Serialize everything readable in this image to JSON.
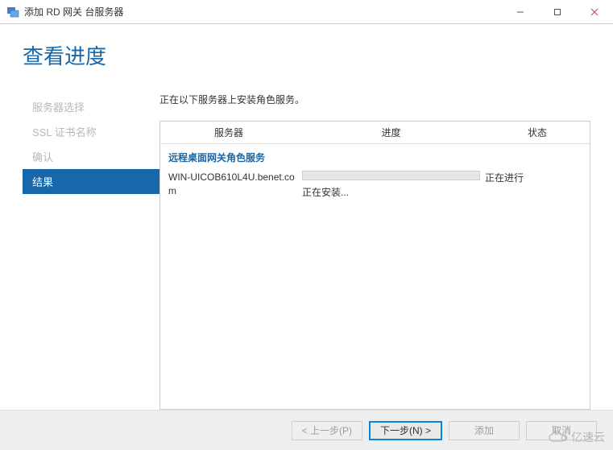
{
  "window": {
    "title": "添加 RD 网关 台服务器"
  },
  "page": {
    "heading": "查看进度",
    "intro": "正在以下服务器上安装角色服务。"
  },
  "sidebar": {
    "steps": [
      {
        "label": "服务器选择"
      },
      {
        "label": "SSL 证书名称"
      },
      {
        "label": "确认"
      },
      {
        "label": "结果"
      }
    ]
  },
  "table": {
    "headers": {
      "server": "服务器",
      "progress": "进度",
      "status": "状态"
    },
    "section_title": "远程桌面网关角色服务",
    "rows": [
      {
        "server": "WIN-UICOB610L4U.benet.com",
        "progress_text": "正在安装...",
        "status": "正在进行"
      }
    ]
  },
  "buttons": {
    "prev": "< 上一步(P)",
    "next": "下一步(N) >",
    "add": "添加",
    "cancel": "取消"
  },
  "watermark": {
    "text": "亿速云"
  }
}
